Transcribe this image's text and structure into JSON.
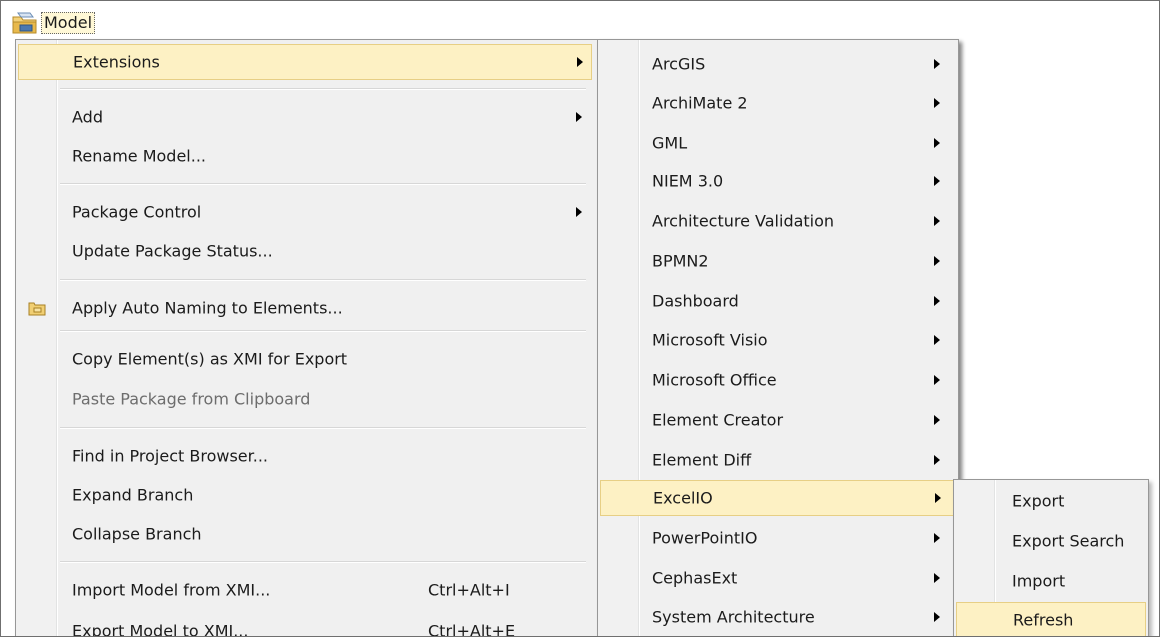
{
  "tree": {
    "root_label": "Model",
    "root_icon": "package-folder-icon"
  },
  "menu1": {
    "items": [
      {
        "label": "Extensions",
        "submenu": true,
        "highlight": true
      },
      {
        "label": "Add",
        "submenu": true
      },
      {
        "label": "Rename Model..."
      },
      {
        "label": "Package Control",
        "submenu": true
      },
      {
        "label": "Update Package Status..."
      },
      {
        "label": "Apply Auto Naming to Elements...",
        "icon": "auto-naming-folder-icon"
      },
      {
        "label": "Copy Element(s) as XMI for Export"
      },
      {
        "label": "Paste Package from Clipboard",
        "disabled": true
      },
      {
        "label": "Find in Project Browser..."
      },
      {
        "label": "Expand Branch"
      },
      {
        "label": "Collapse Branch"
      },
      {
        "label": "Import Model from XMI...",
        "shortcut": "Ctrl+Alt+I"
      },
      {
        "label": "Export Model to XMI...",
        "shortcut": "Ctrl+Alt+E"
      }
    ]
  },
  "menu2": {
    "items": [
      {
        "label": "ArcGIS",
        "submenu": true
      },
      {
        "label": "ArchiMate 2",
        "submenu": true
      },
      {
        "label": "GML",
        "submenu": true
      },
      {
        "label": "NIEM 3.0",
        "submenu": true
      },
      {
        "label": "Architecture Validation",
        "submenu": true
      },
      {
        "label": "BPMN2",
        "submenu": true
      },
      {
        "label": "Dashboard",
        "submenu": true
      },
      {
        "label": "Microsoft Visio",
        "submenu": true
      },
      {
        "label": "Microsoft Office",
        "submenu": true
      },
      {
        "label": "Element Creator",
        "submenu": true
      },
      {
        "label": "Element Diff",
        "submenu": true
      },
      {
        "label": "ExcelIO",
        "submenu": true,
        "highlight": true
      },
      {
        "label": "PowerPointIO",
        "submenu": true
      },
      {
        "label": "CephasExt",
        "submenu": true
      },
      {
        "label": "System Architecture",
        "submenu": true
      }
    ]
  },
  "menu3": {
    "items": [
      {
        "label": "Export"
      },
      {
        "label": "Export Search"
      },
      {
        "label": "Import"
      },
      {
        "label": "Refresh",
        "highlight": true
      }
    ]
  },
  "colors": {
    "menu_bg": "#f0f0f0",
    "highlight_bg": "#fdf1c4",
    "highlight_border": "#e7cf85"
  }
}
